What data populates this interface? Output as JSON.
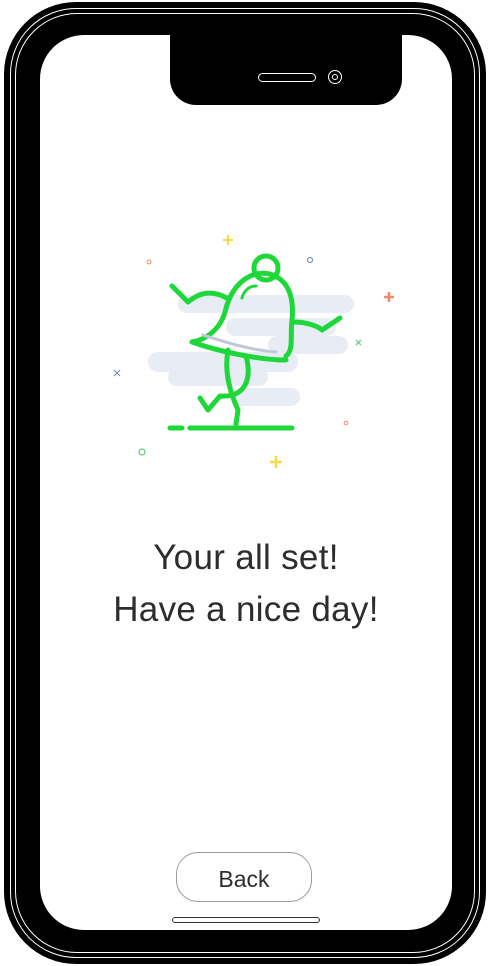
{
  "message": {
    "line1": "Your all set!",
    "line2": "Have a nice day!"
  },
  "back_button": {
    "label": "Back"
  },
  "colors": {
    "accent": "#1ed83a",
    "cloud": "#e8ecf4",
    "text": "#2d2d2d"
  },
  "icons": [
    "dancing-bell-illustration"
  ]
}
